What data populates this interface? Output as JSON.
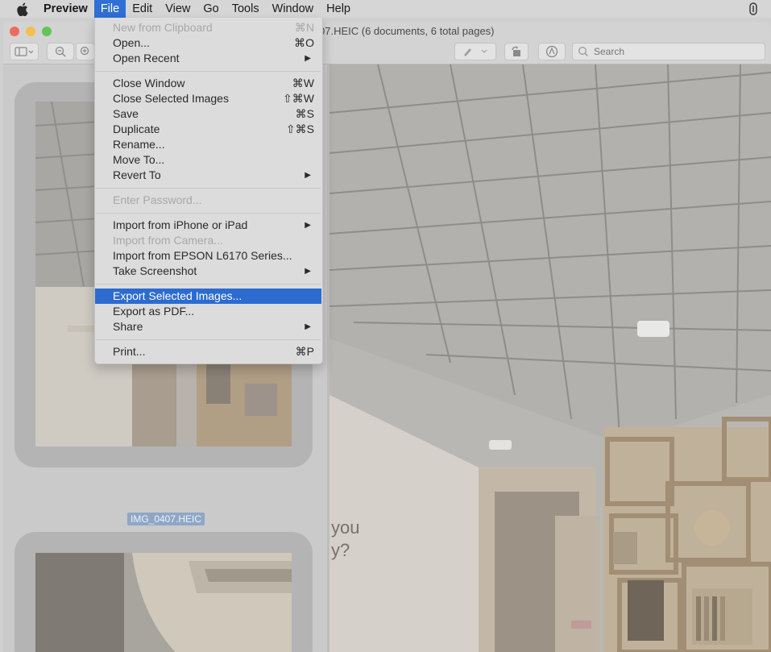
{
  "menubar": {
    "app_name": "Preview",
    "items": [
      "File",
      "Edit",
      "View",
      "Go",
      "Tools",
      "Window",
      "Help"
    ]
  },
  "window": {
    "title": "07.HEIC (6 documents, 6 total pages)",
    "search_placeholder": "Search"
  },
  "sidebar": {
    "selected_label": "IMG_0407.HEIC"
  },
  "file_menu": {
    "new_from_clipboard": {
      "label": "New from Clipboard",
      "shortcut": "⌘N"
    },
    "open": {
      "label": "Open...",
      "shortcut": "⌘O"
    },
    "open_recent": {
      "label": "Open Recent"
    },
    "close_window": {
      "label": "Close Window",
      "shortcut": "⌘W"
    },
    "close_selected": {
      "label": "Close Selected Images",
      "shortcut": "⇧⌘W"
    },
    "save": {
      "label": "Save",
      "shortcut": "⌘S"
    },
    "duplicate": {
      "label": "Duplicate",
      "shortcut": "⇧⌘S"
    },
    "rename": {
      "label": "Rename..."
    },
    "move_to": {
      "label": "Move To..."
    },
    "revert_to": {
      "label": "Revert To"
    },
    "enter_password": {
      "label": "Enter Password..."
    },
    "import_iphone": {
      "label": "Import from iPhone or iPad"
    },
    "import_camera": {
      "label": "Import from Camera..."
    },
    "import_epson": {
      "label": "Import from EPSON L6170 Series..."
    },
    "take_screenshot": {
      "label": "Take Screenshot"
    },
    "export_selected": {
      "label": "Export Selected Images..."
    },
    "export_pdf": {
      "label": "Export as PDF..."
    },
    "share": {
      "label": "Share"
    },
    "print": {
      "label": "Print...",
      "shortcut": "⌘P"
    }
  },
  "icons": {
    "submenu_arrow": "▶"
  },
  "colors": {
    "highlight": "#2c6bd0",
    "menubar_active": "#2f6fd6"
  }
}
